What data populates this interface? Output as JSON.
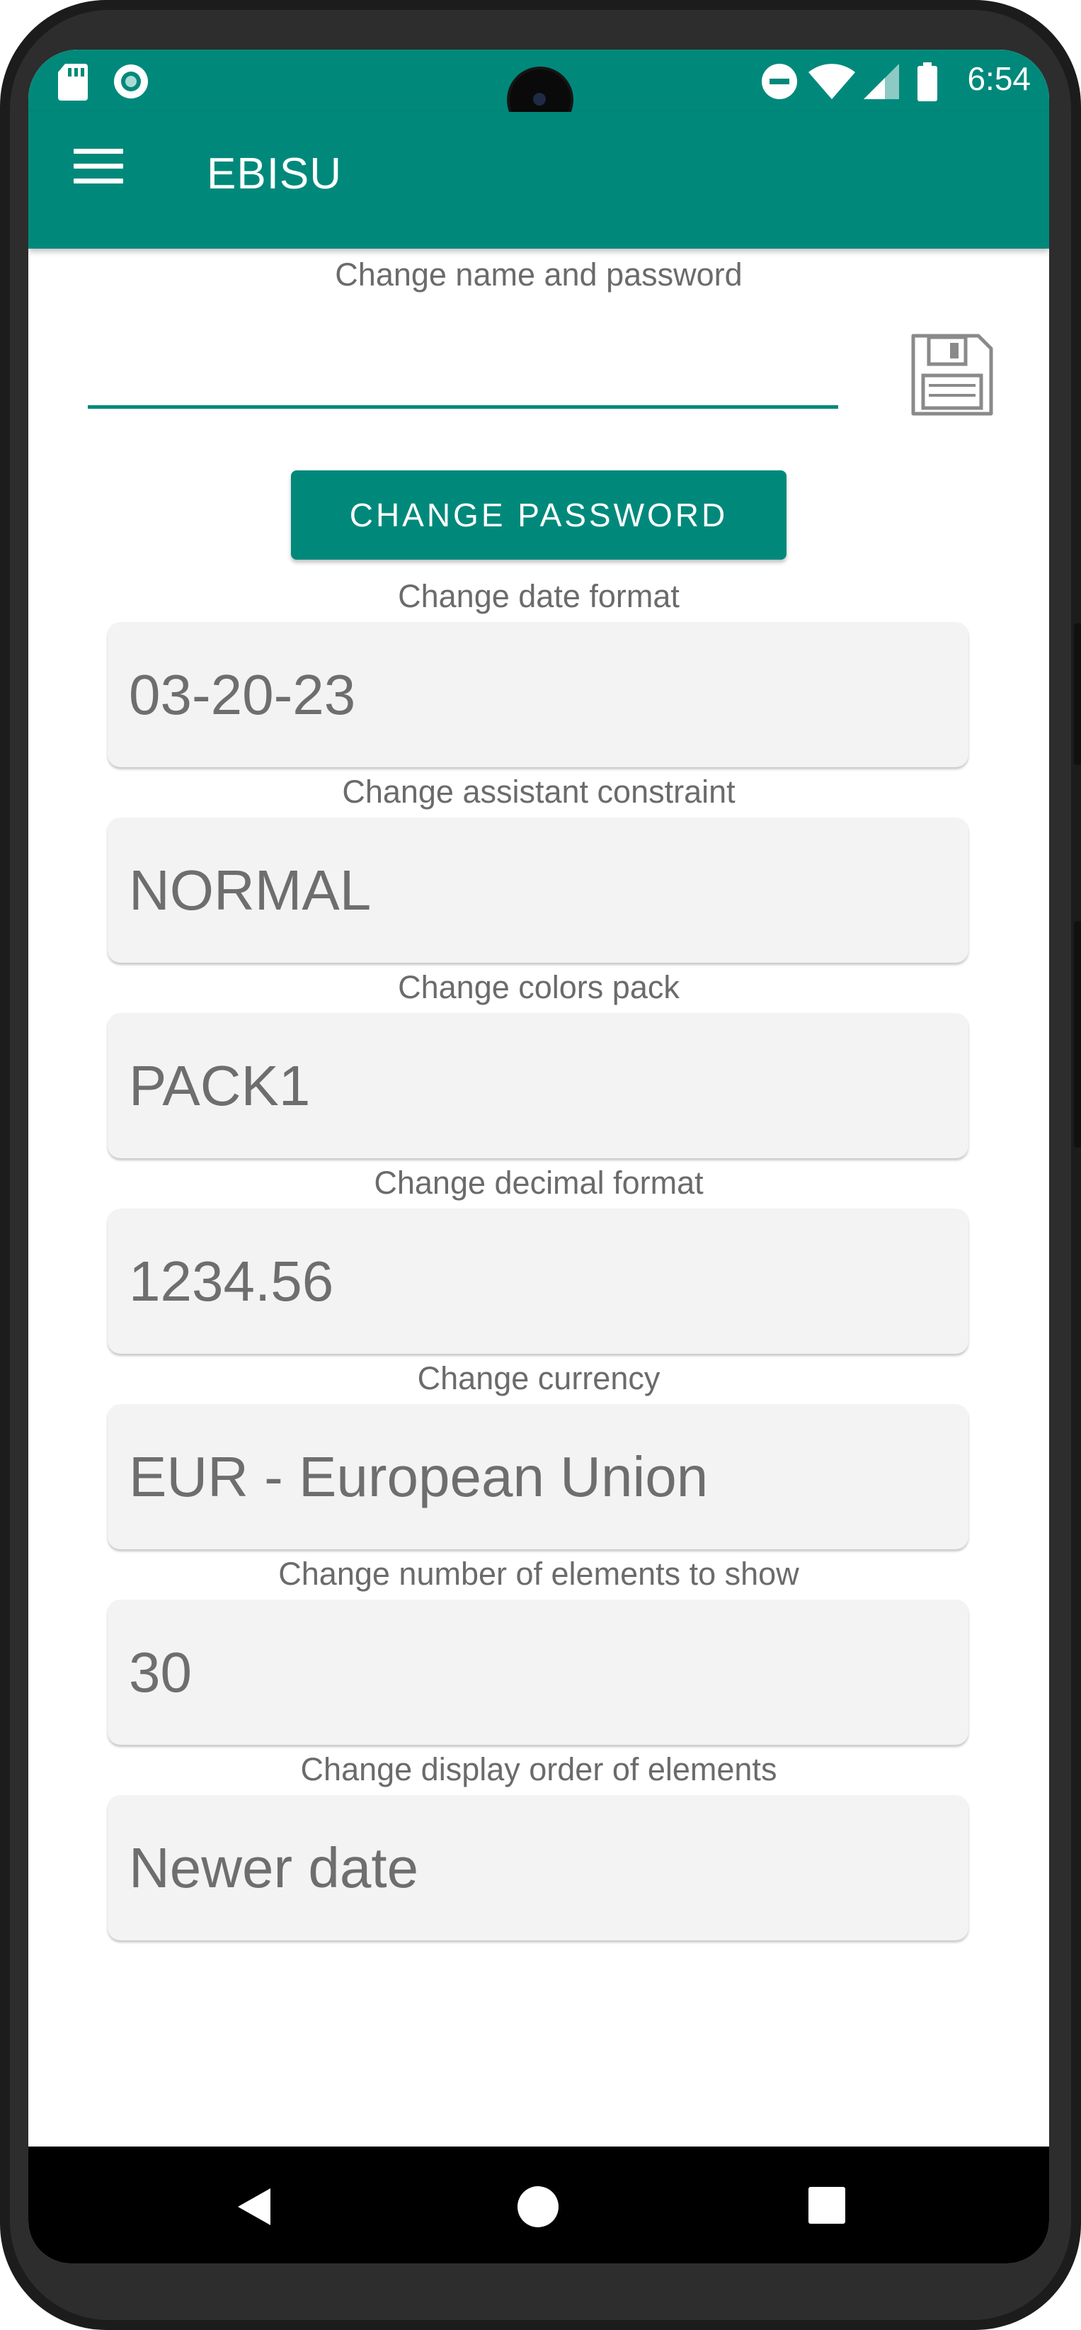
{
  "status_bar": {
    "time": "6:54",
    "icons": [
      "sd-card-icon",
      "sync-icon",
      "do-not-disturb-icon",
      "wifi-icon",
      "signal-icon",
      "battery-icon"
    ]
  },
  "app_bar": {
    "title": "EBISU",
    "menu_icon": "menu-icon"
  },
  "account": {
    "label": "Change name and password",
    "name_value": "",
    "save_icon": "save-icon",
    "change_password_label": "CHANGE PASSWORD"
  },
  "settings": [
    {
      "label": "Change date format",
      "value": "03-20-23"
    },
    {
      "label": "Change assistant constraint",
      "value": "NORMAL"
    },
    {
      "label": "Change colors pack",
      "value": "PACK1"
    },
    {
      "label": "Change decimal format",
      "value": "1234.56"
    },
    {
      "label": "Change currency",
      "value": "EUR - European Union"
    },
    {
      "label": "Change number of elements to show",
      "value": "30"
    },
    {
      "label": "Change display order of elements",
      "value": "Newer date"
    }
  ],
  "nav_bar": {
    "icons": [
      "back-icon",
      "home-icon",
      "recents-icon"
    ]
  },
  "colors": {
    "accent": "#00897b",
    "field_background": "#f3f3f3",
    "label_text": "#6b6b6b"
  }
}
